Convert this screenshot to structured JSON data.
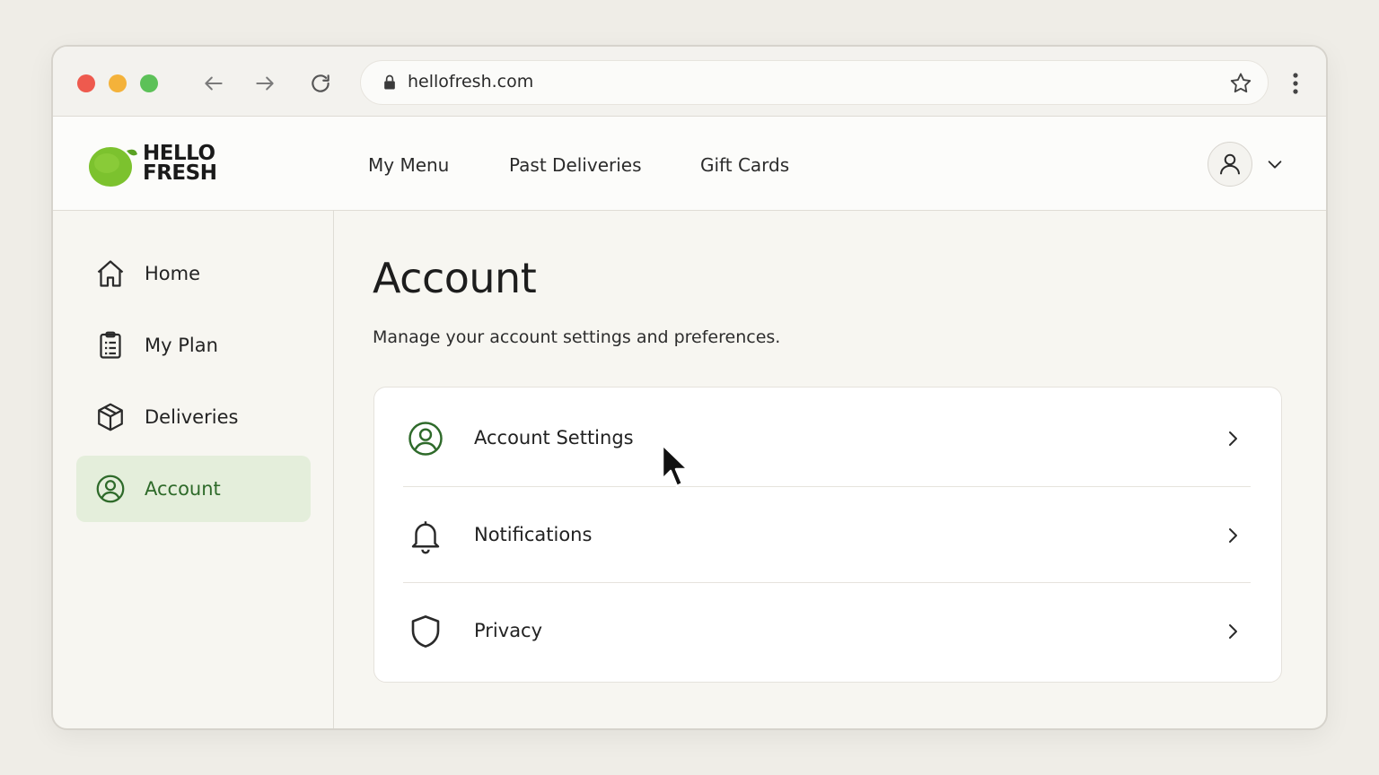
{
  "browser": {
    "url": "hellofresh.com"
  },
  "header": {
    "logo_line1": "HELLO",
    "logo_line2": "FRESH",
    "nav": [
      {
        "label": "My Menu"
      },
      {
        "label": "Past Deliveries"
      },
      {
        "label": "Gift Cards"
      }
    ]
  },
  "sidebar": {
    "items": [
      {
        "label": "Home",
        "icon": "home-icon"
      },
      {
        "label": "My Plan",
        "icon": "clipboard-icon"
      },
      {
        "label": "Deliveries",
        "icon": "box-icon"
      },
      {
        "label": "Account",
        "icon": "user-circle-icon",
        "active": true
      }
    ]
  },
  "main": {
    "title": "Account",
    "subtitle": "Manage your account settings and preferences.",
    "rows": [
      {
        "label": "Account Settings",
        "icon": "user-circle-icon"
      },
      {
        "label": "Notifications",
        "icon": "bell-icon"
      },
      {
        "label": "Privacy",
        "icon": "shield-icon"
      }
    ]
  },
  "colors": {
    "accent_green": "#2e6a2a",
    "active_bg": "#e4eedb",
    "logo_green": "#7cc22e"
  }
}
